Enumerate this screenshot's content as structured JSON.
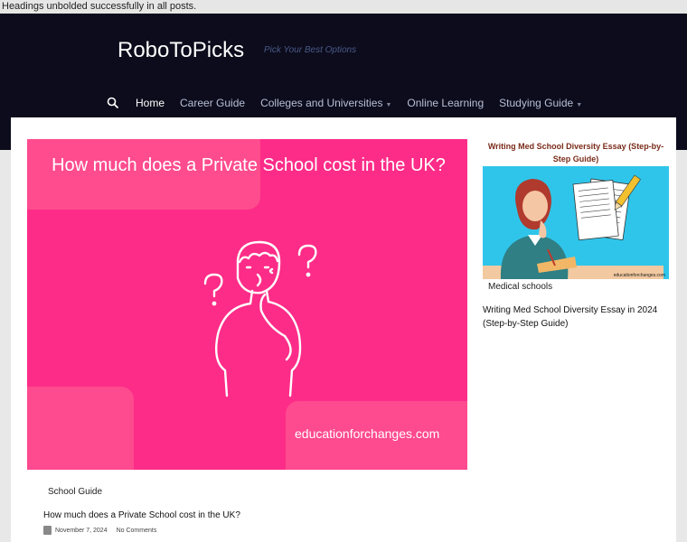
{
  "notice": {
    "text": "Headings unbolded successfully in all posts."
  },
  "header": {
    "site_title": "RoboToPicks",
    "tagline": "Pick Your Best Options",
    "search_icon": "search-icon",
    "nav": [
      {
        "label": "Home",
        "active": true,
        "dropdown": false
      },
      {
        "label": "Career Guide",
        "active": false,
        "dropdown": false
      },
      {
        "label": "Colleges and Universities",
        "active": false,
        "dropdown": true
      },
      {
        "label": "Online Learning",
        "active": false,
        "dropdown": false
      },
      {
        "label": "Studying Guide",
        "active": false,
        "dropdown": true
      }
    ]
  },
  "main_post": {
    "image_title": "How much does a Private School cost in the UK?",
    "image_site": "educationforchanges.com",
    "category": "School Guide",
    "title": "How much does a Private School cost in the UK?",
    "date": "November 7, 2024",
    "comments": "No Comments",
    "image_color": "#fd2c88"
  },
  "sidebar_post": {
    "image_title": "Writing Med School Diversity Essay (Step-by-Step Guide)",
    "image_site": "educationforchanges.com",
    "category": "Medical schools",
    "title": "Writing Med School Diversity Essay in 2024 (Step-by-Step Guide)",
    "image_color": "#2fc5ea"
  },
  "colors": {
    "header_bg": "#0c0c1c",
    "accent": "#fd2c88"
  }
}
